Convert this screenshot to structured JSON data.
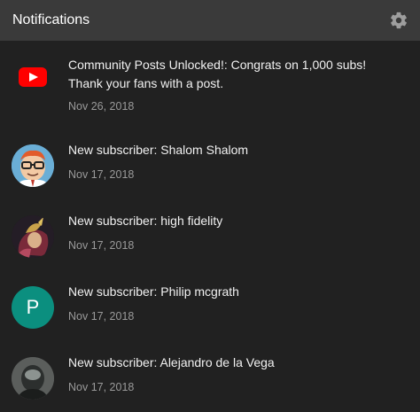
{
  "header": {
    "title": "Notifications",
    "settings_icon": "gear-icon"
  },
  "notifications": [
    {
      "icon": "youtube-logo-icon",
      "text": "Community Posts Unlocked!: Congrats on 1,000 subs! Thank your fans with a post.",
      "date": "Nov 26, 2018"
    },
    {
      "icon": "cartoon-avatar",
      "text": "New subscriber: Shalom Shalom",
      "date": "Nov 17, 2018"
    },
    {
      "icon": "character-avatar",
      "text": "New subscriber: high fidelity",
      "date": "Nov 17, 2018"
    },
    {
      "icon": "letter-avatar",
      "avatar_letter": "P",
      "avatar_color": "#0b8f7f",
      "text": "New subscriber: Philip mcgrath",
      "date": "Nov 17, 2018"
    },
    {
      "icon": "photo-avatar",
      "text": "New subscriber: Alejandro de la Vega",
      "date": "Nov 17, 2018"
    }
  ],
  "colors": {
    "background": "#212121",
    "header": "#3a3a3a",
    "date_text": "#9a9a9a",
    "youtube_red": "#ff0000"
  }
}
